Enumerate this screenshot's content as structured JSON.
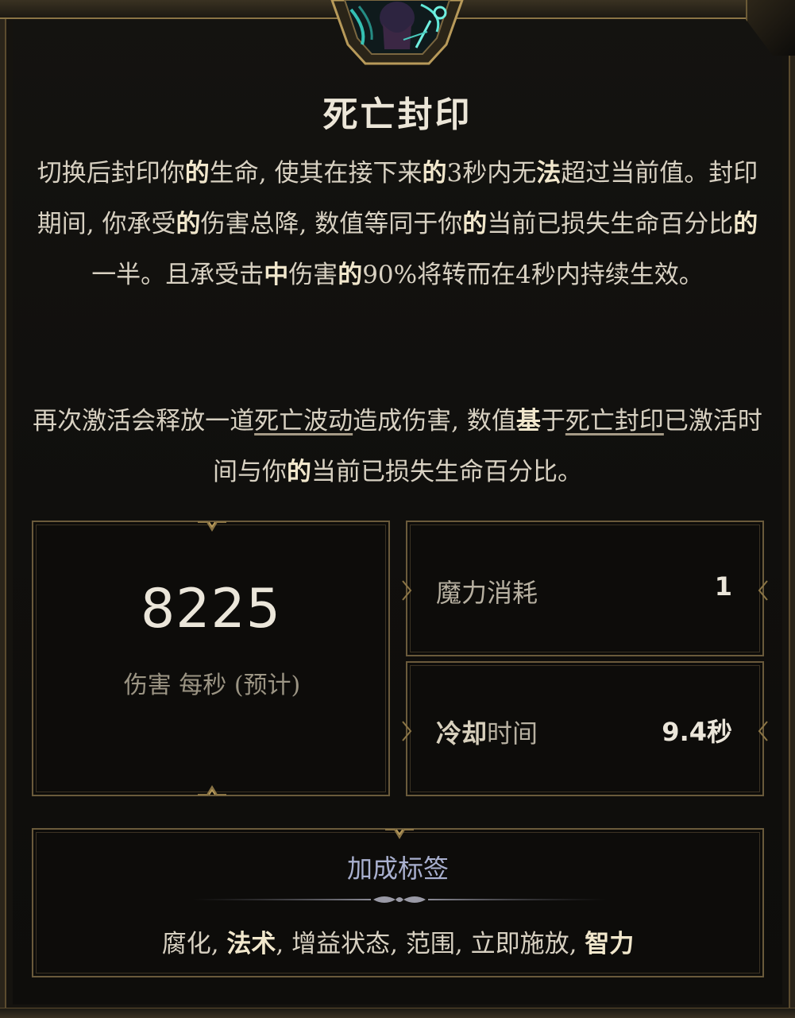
{
  "skill": {
    "title": "死亡封印",
    "icon": "death-seal-portrait-icon"
  },
  "description": {
    "para1": [
      {
        "t": "切换后封印你",
        "s": ""
      },
      {
        "t": "的",
        "s": "hl"
      },
      {
        "t": "生命, 使其在接下来",
        "s": ""
      },
      {
        "t": "的",
        "s": "hl"
      },
      {
        "t": "3秒内无",
        "s": ""
      },
      {
        "t": "法",
        "s": "hl"
      },
      {
        "t": "超过当前值。封印期间, 你承受",
        "s": ""
      },
      {
        "t": "的",
        "s": "hl"
      },
      {
        "t": "伤害总降, 数值等同于你",
        "s": ""
      },
      {
        "t": "的",
        "s": "hl"
      },
      {
        "t": "当前已损失生命百分比",
        "s": ""
      },
      {
        "t": "的",
        "s": "hl"
      },
      {
        "t": "一半。且承受击",
        "s": ""
      },
      {
        "t": "中",
        "s": "hl"
      },
      {
        "t": "伤害",
        "s": ""
      },
      {
        "t": "的",
        "s": "hl"
      },
      {
        "t": "90%将转而在4秒内持续生效。",
        "s": ""
      }
    ],
    "para2": [
      {
        "t": "再次激活会释放一道",
        "s": ""
      },
      {
        "t": "死亡波动",
        "s": "ul"
      },
      {
        "t": "造成伤害, 数值",
        "s": ""
      },
      {
        "t": "基",
        "s": "hl"
      },
      {
        "t": "于",
        "s": ""
      },
      {
        "t": "死亡封印",
        "s": "ul"
      },
      {
        "t": "已激活时间与你",
        "s": ""
      },
      {
        "t": "的",
        "s": "hl"
      },
      {
        "t": "当前已损失生命百分比。",
        "s": ""
      }
    ]
  },
  "damage": {
    "value": "8225",
    "label": "伤害 每秒 (预计)"
  },
  "stats": {
    "mana_label_bold": "",
    "mana_label": "魔力消耗",
    "mana_value": "1",
    "cooldown_label_bold": "冷却",
    "cooldown_label": "时间",
    "cooldown_value": "9.4秒"
  },
  "tags": {
    "title": "加成标签",
    "items": [
      {
        "t": "腐化",
        "s": ""
      },
      {
        "t": "法术",
        "s": "hl"
      },
      {
        "t": "增益状态",
        "s": ""
      },
      {
        "t": "范围",
        "s": ""
      },
      {
        "t": "立即施放",
        "s": ""
      },
      {
        "t": "智力",
        "s": "hl"
      }
    ],
    "separator": ", "
  },
  "colors": {
    "gold_border": "#6a5a3b",
    "text_main": "#d8d1c2",
    "highlight": "#f1e7cc",
    "tag_title": "#a9b0cf",
    "portrait_glow": "#39d3c4"
  }
}
